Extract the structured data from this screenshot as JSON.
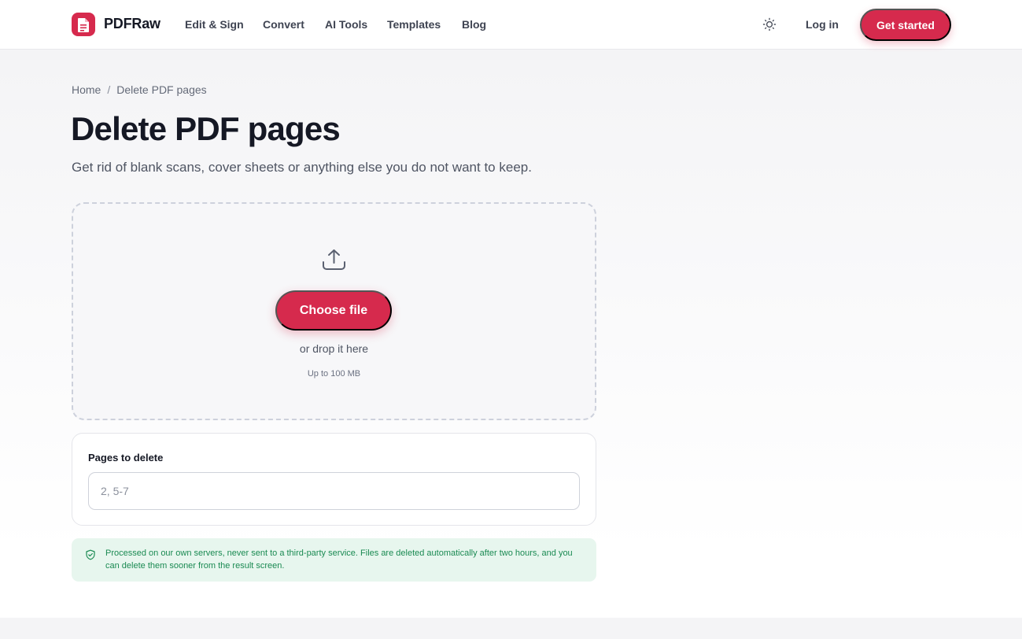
{
  "header": {
    "brand": "PDFRaw",
    "nav": [
      "Edit & Sign",
      "Convert",
      "AI Tools",
      "Templates",
      "Blog"
    ],
    "login_label": "Log in",
    "cta_label": "Get started",
    "theme_icon": "sun-icon",
    "logo_icon": "document-icon"
  },
  "breadcrumb": {
    "home": "Home",
    "separator": "/",
    "current": "Delete PDF pages"
  },
  "page": {
    "title": "Delete PDF pages",
    "subtitle": "Get rid of blank scans, cover sheets or anything else you do not want to keep."
  },
  "dropzone": {
    "icon": "upload-icon",
    "button_label": "Choose file",
    "hint": "or drop it here",
    "size_limit": "Up to 100 MB"
  },
  "options": {
    "pages_label": "Pages to delete",
    "pages_placeholder": "2, 5-7",
    "pages_value": ""
  },
  "notice": {
    "icon": "shield-check-icon",
    "text": "Processed on our own servers, never sent to a third-party service. Files are deleted automatically after two hours, and you can delete them sooner from the result screen."
  },
  "colors": {
    "accent": "#d62a4d",
    "notice_bg": "#e7f6ee",
    "notice_text": "#1a8a52"
  }
}
